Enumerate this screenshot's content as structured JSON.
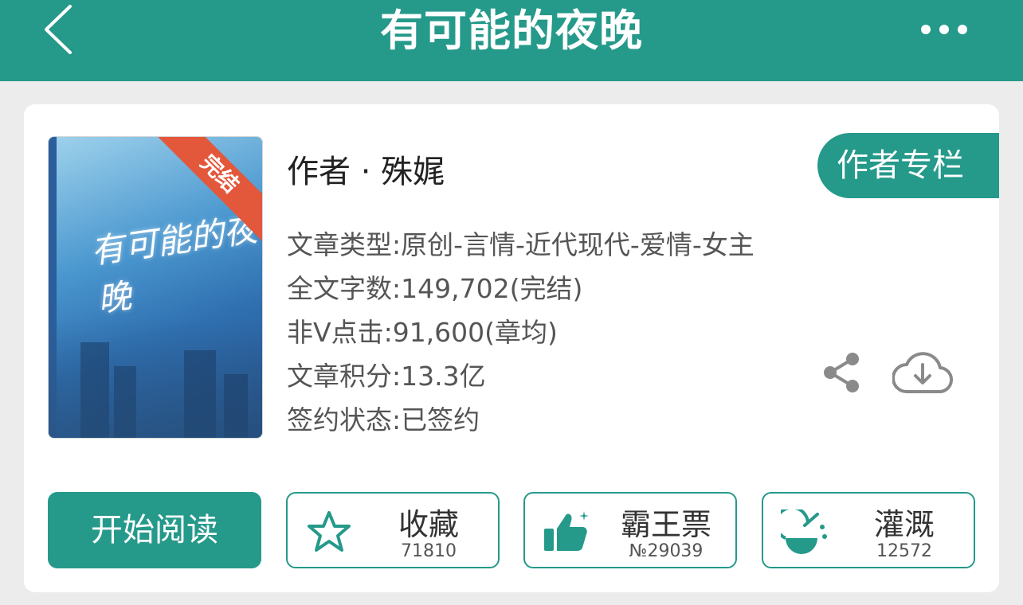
{
  "header": {
    "title": "有可能的夜晚"
  },
  "book": {
    "cover_badge": "完结",
    "cover_art_title": "有可能的夜晚",
    "author_line": "作者 · 殊娓",
    "author_column_label": "作者专栏",
    "info": [
      "文章类型:原创-言情-近代现代-爱情-女主",
      "全文字数:149,702(完结)",
      "非V点击:91,600(章均)",
      "文章积分:13.3亿",
      "签约状态:已签约"
    ]
  },
  "actions": {
    "read_label": "开始阅读",
    "favorite": {
      "label": "收藏",
      "count": "71810"
    },
    "ticket": {
      "label": "霸王票",
      "count": "№29039"
    },
    "nutrient": {
      "label": "灌溉",
      "count": "12572"
    }
  },
  "icons": [
    "back-arrow-icon",
    "more-dots-icon",
    "share-icon",
    "cloud-download-icon",
    "star-icon",
    "thumbs-up-icon",
    "flask-icon"
  ],
  "colors": {
    "accent": "#25998a",
    "badge": "#e3573b",
    "background": "#ececec"
  }
}
